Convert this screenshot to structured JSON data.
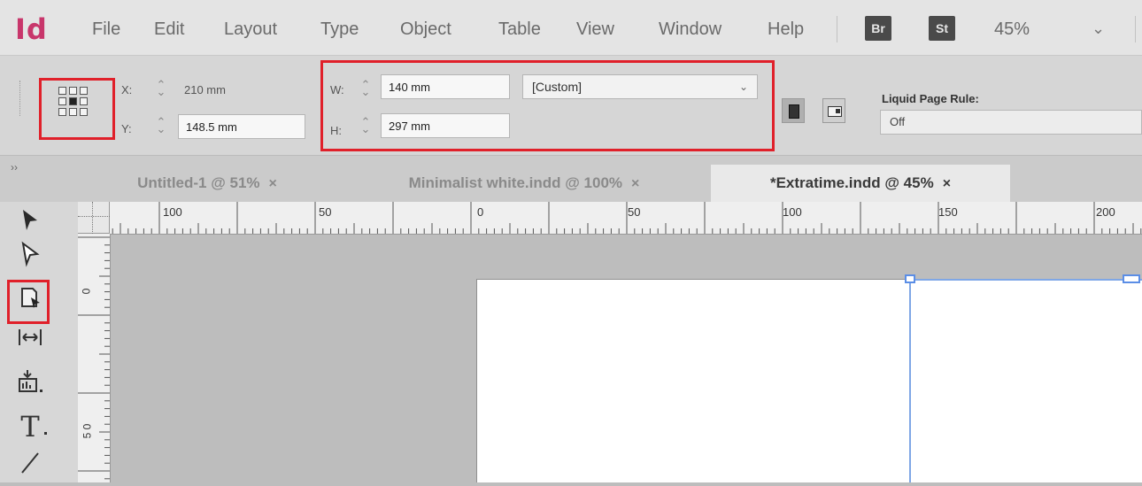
{
  "app": {
    "logo": "Id",
    "menu": [
      "File",
      "Edit",
      "Layout",
      "Type",
      "Object",
      "Table",
      "View",
      "Window",
      "Help"
    ],
    "bridge_badge": "Br",
    "stock_badge": "St",
    "zoom": "45%",
    "zoom_chevron": "⌄"
  },
  "control_panel": {
    "x_label": "X:",
    "x_value": "210 mm",
    "y_label": "Y:",
    "y_value": "148.5 mm",
    "w_label": "W:",
    "w_value": "140 mm",
    "h_label": "H:",
    "h_value": "297 mm",
    "page_size": "[Custom]",
    "liquid_label": "Liquid Page Rule:",
    "liquid_value": "Off"
  },
  "tabs": [
    {
      "label": "Untitled-1 @ 51%",
      "close": "×"
    },
    {
      "label": "Minimalist white.indd @ 100%",
      "close": "×"
    },
    {
      "label": "*Extratime.indd @ 45%",
      "close": "×"
    }
  ],
  "ruler": {
    "h_labels": [
      "100",
      "50",
      "0",
      "50",
      "100",
      "150",
      "200"
    ],
    "v_labels": [
      "0",
      "5 0"
    ]
  },
  "highlight_color": "#e0202a",
  "icons": {
    "selection": "selection-arrow-icon",
    "direct_selection": "direct-selection-icon",
    "page_tool": "page-tool-icon",
    "gap_tool": "gap-tool-icon",
    "content_collector": "content-collector-icon",
    "type_tool": "type-tool-icon",
    "line_tool": "line-tool-icon"
  }
}
